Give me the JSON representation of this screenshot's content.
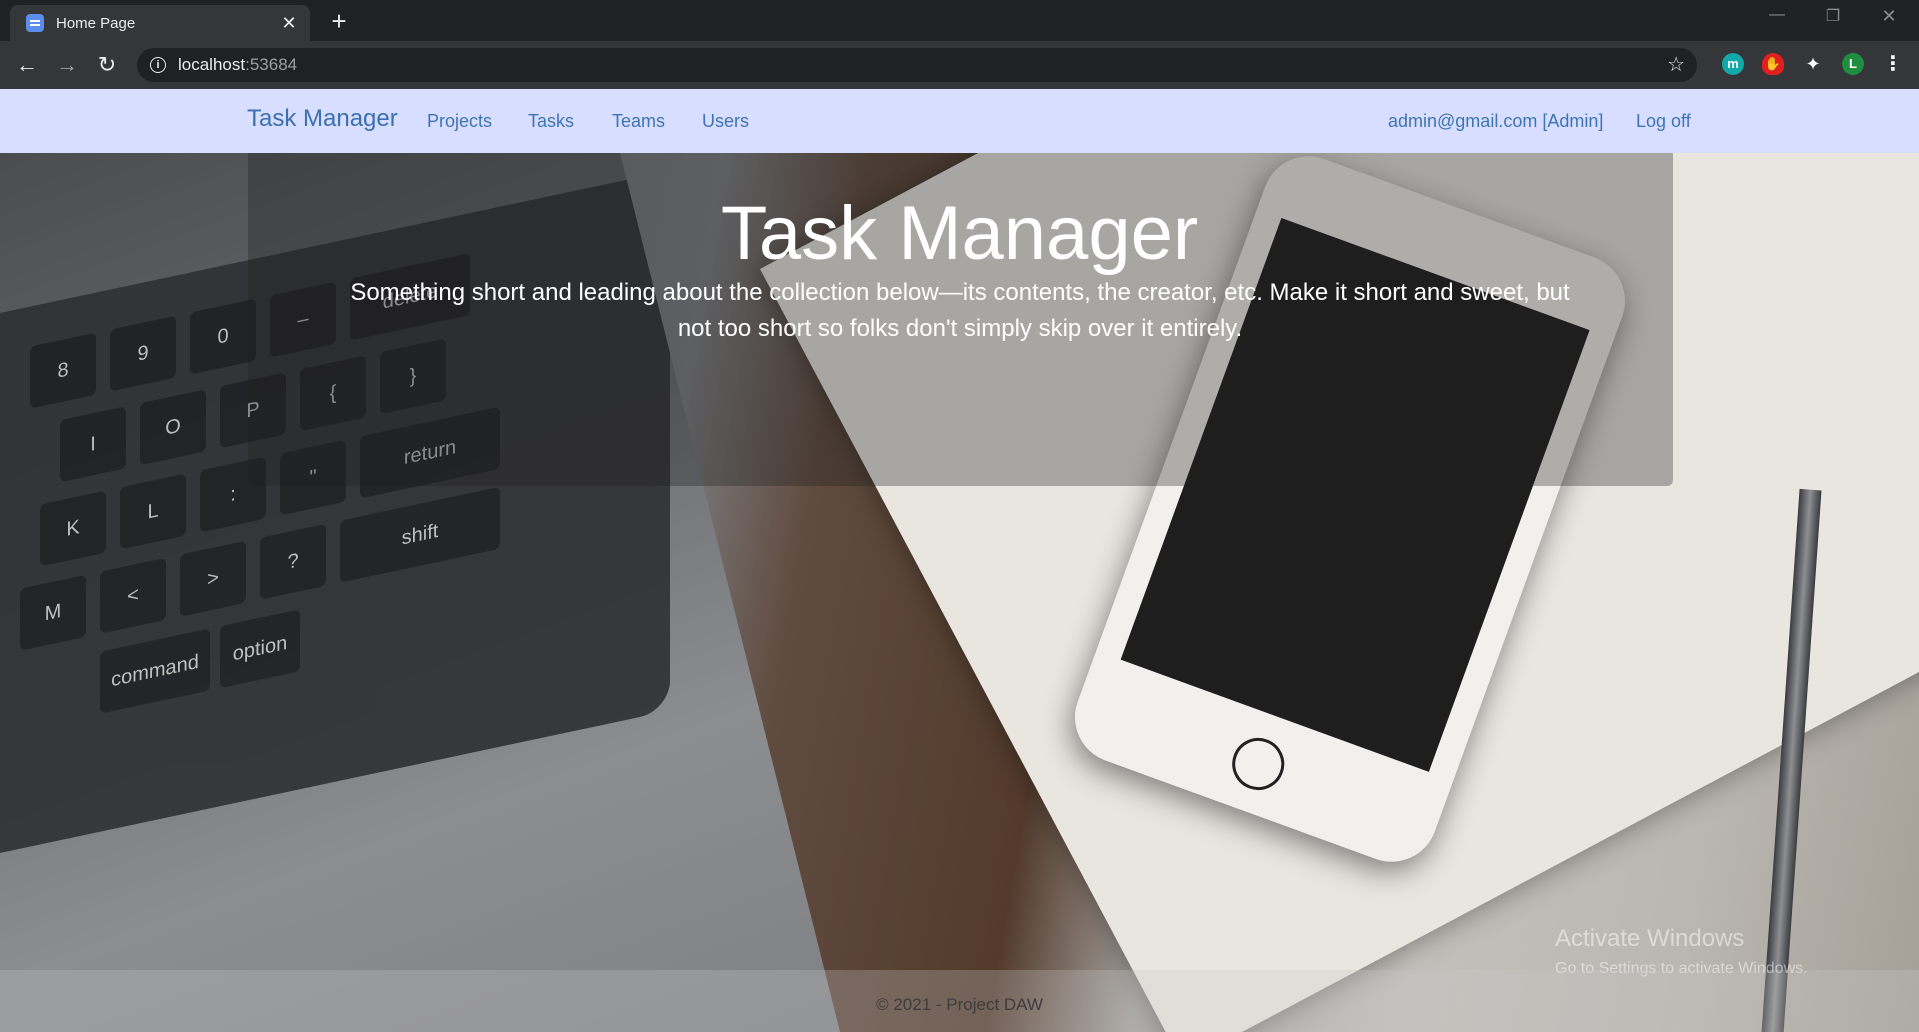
{
  "browser": {
    "tab_title": "Home Page",
    "tab_close": "✕",
    "new_tab": "+",
    "url_host": "localhost",
    "url_port": ":53684",
    "extensions": [
      "m",
      "L"
    ]
  },
  "navbar": {
    "brand": "Task Manager",
    "links": [
      "Projects",
      "Tasks",
      "Teams",
      "Users"
    ],
    "user": "admin@gmail.com [Admin]",
    "logoff": "Log off"
  },
  "hero": {
    "title": "Task Manager",
    "text": "Something short and leading about the collection below—its contents, the creator, etc. Make it short and sweet, but not too short so folks don't simply skip over it entirely."
  },
  "footer": {
    "text": "© 2021 - Project DAW"
  },
  "watermark": {
    "title": "Activate Windows",
    "subtitle": "Go to Settings to activate Windows."
  },
  "colors": {
    "navbar_bg": "#d7deff",
    "link": "#3f73b4"
  }
}
